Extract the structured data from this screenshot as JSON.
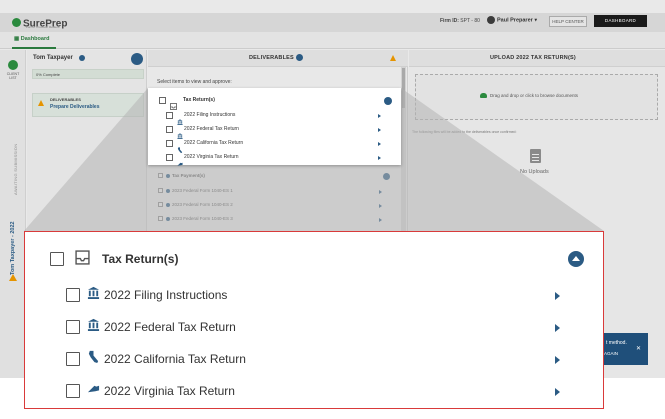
{
  "app": {
    "logo_text": "SurePrep",
    "logo_sub": "Part of Thomson Reuters"
  },
  "header": {
    "firm_id_label": "Firm ID:",
    "firm_id_value": "SPT - 80",
    "user_name": "Paul Preparer",
    "help_label": "HELP CENTER",
    "dashboard_label": "DASHBOARD"
  },
  "tabs": {
    "dashboard": "Dashboard"
  },
  "rail": {
    "client_list_label": "CLIENT LIST",
    "awaiting_label": "AWAITING SUBMISSION",
    "client_vertical": "Tom Taxpayer - 2022"
  },
  "client": {
    "name": "Tom Taxpayer",
    "progress_text": "0% Complete",
    "progress_fraction": 0.0,
    "deliverables_title": "DELIVERABLES",
    "deliverables_subtitle": "Prepare Deliverables"
  },
  "deliverables": {
    "header": "DELIVERABLES",
    "select_hint": "Select items to view and approve:",
    "tax_returns_group": "Tax Return(s)",
    "tax_returns_items": [
      "2022 Filing Instructions",
      "2022 Federal Tax Return",
      "2022 California Tax Return",
      "2022 Virginia Tax Return"
    ],
    "tax_payments_group": "Tax Payment(s)",
    "tax_payments_items": [
      "2023 Federal Form 1040-ES 1",
      "2023 Federal Form 1040-ES 2",
      "2023 Federal Form 1040-ES 3"
    ]
  },
  "upload": {
    "header": "UPLOAD 2022 TAX RETURN(S)",
    "drop_text": "Drag and drop or click to browse documents",
    "note": "The following files will be added to the deliverables once confirmed:",
    "empty_text": "No Uploads"
  },
  "toast": {
    "line1": "t method.",
    "line2": "S AGAIN"
  },
  "icons": {
    "group": "inbox-tray-icon",
    "filing": "bank-icon",
    "federal": "bank-icon",
    "california": "california-state-icon",
    "virginia": "virginia-state-icon",
    "collapse": "chevron-up-icon",
    "expand": "chevron-right-icon"
  },
  "colors": {
    "brand_green": "#2b8a3e",
    "primary_blue": "#2b5b84",
    "warning": "#e59400",
    "zoom_border": "#d93a3a"
  }
}
